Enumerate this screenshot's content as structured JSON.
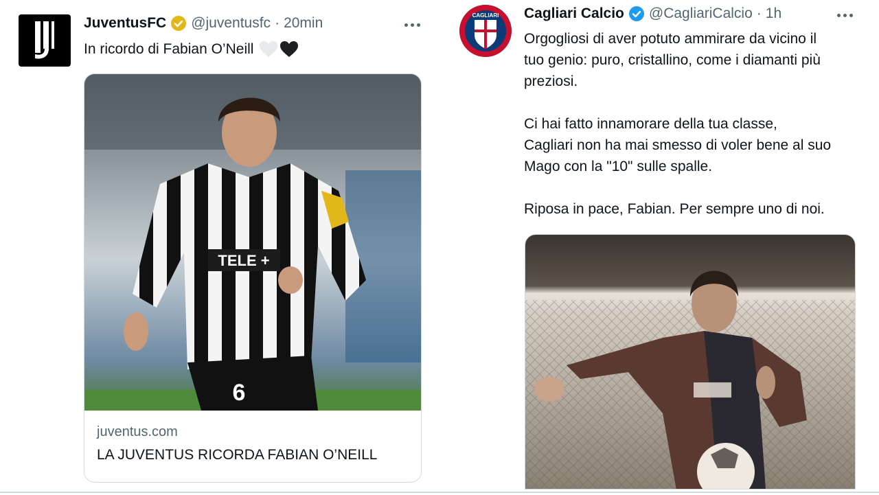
{
  "left_tweet": {
    "name": "JuventusFC",
    "handle": "@juventusfc",
    "separator": "·",
    "time": "20min",
    "text": "In ricordo di Fabian O’Neill",
    "card": {
      "domain": "juventus.com",
      "title": "LA JUVENTUS RICORDA FABIAN O’NEILL"
    },
    "photo_text": {
      "sponsor": "TELE +",
      "number": "6"
    },
    "colors": {
      "badge": "#e2b719",
      "white_heart": "#e7e9ea",
      "black_heart": "#1d1f23"
    }
  },
  "right_tweet": {
    "name": "Cagliari Calcio",
    "handle": "@CagliariCalcio",
    "separator": "·",
    "time": "1h",
    "text": "Orgogliosi di aver potuto ammirare da vicino il\ntuo genio: puro, cristallino, come i diamanti più\npreziosi.\n\nCi hai fatto innamorare della tua classe,\nCagliari non ha mai smesso di voler bene al suo\nMago con la \"10\" sulle spalle.\n\nRiposa in pace, Fabian. Per sempre uno di noi.",
    "avatar_text": "CAGLIARI",
    "colors": {
      "badge": "#1d9bf0",
      "crest_red": "#c8102e",
      "crest_blue": "#0b3a78"
    }
  }
}
